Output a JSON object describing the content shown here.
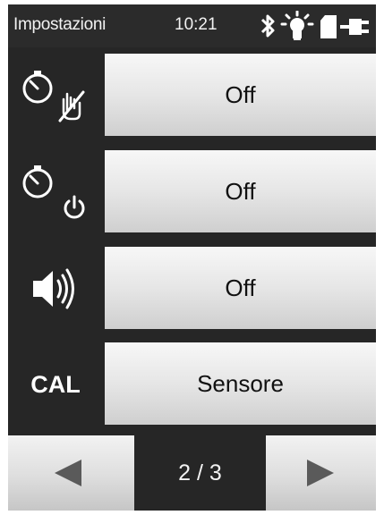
{
  "statusbar": {
    "title": "Impostazioni",
    "time": "10:21",
    "icons": [
      "bluetooth-icon",
      "light-bulb-icon",
      "sd-card-icon",
      "power-plug-icon"
    ]
  },
  "rows": [
    {
      "icon": "stopwatch-no-touch-icon",
      "value": "Off"
    },
    {
      "icon": "stopwatch-power-icon",
      "value": "Off"
    },
    {
      "icon": "speaker-icon",
      "value": "Off"
    },
    {
      "icon_text": "CAL",
      "value": "Sensore"
    }
  ],
  "nav": {
    "prev_icon": "left-arrow-icon",
    "page": "2 / 3",
    "next_icon": "right-arrow-icon"
  },
  "colors": {
    "background": "#262626",
    "button_light": "#f7f7f7",
    "button_dark": "#cfcfcf",
    "text_light": "#f2f2f2"
  }
}
